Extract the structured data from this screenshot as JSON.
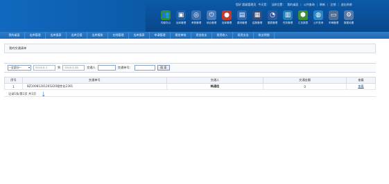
{
  "topbar": [
    "您好 超级管理员",
    "今天是：",
    "当前位置：",
    "我的桌面",
    "公共查询",
    "刷新",
    "注销",
    "退出系统"
  ],
  "modules": [
    {
      "label": "内部办公",
      "icon": "people-icon",
      "color": "#2f8f3a",
      "glyph": "👥"
    },
    {
      "label": "出库管理",
      "icon": "box-out-icon",
      "color": "#1e5fa6",
      "glyph": "▣"
    },
    {
      "label": "考核管理",
      "icon": "target-icon",
      "color": "#3a6fb2",
      "glyph": "◎"
    },
    {
      "label": "综合管理",
      "icon": "power-icon",
      "color": "#4b7cb9",
      "glyph": "⏻"
    },
    {
      "label": "出库管理",
      "icon": "alert-icon",
      "color": "#c33a2f",
      "glyph": "●"
    },
    {
      "label": "费用管理",
      "icon": "document-icon",
      "color": "#2a6bb8",
      "glyph": "▤"
    },
    {
      "label": "结报管理",
      "icon": "report-icon",
      "color": "#37507a",
      "glyph": "▦"
    },
    {
      "label": "图表管理",
      "icon": "dashboard-icon",
      "color": "#2c5aa0",
      "glyph": "◔"
    },
    {
      "label": "任务管理",
      "icon": "chart-icon",
      "color": "#1f7fbf",
      "glyph": "▥"
    },
    {
      "label": "汇总报表",
      "icon": "shop-icon",
      "color": "#3d8d3b",
      "glyph": "⬢"
    },
    {
      "label": "公开查询",
      "icon": "globe-icon",
      "color": "#2b86c6",
      "glyph": "◍"
    },
    {
      "label": "车辆管理",
      "icon": "monitor-icon",
      "color": "#4f6f96",
      "glyph": "▭"
    },
    {
      "label": "数据设置",
      "icon": "settings-icon",
      "color": "#557aa6",
      "glyph": "⚙"
    }
  ],
  "nav": [
    "我的桌面",
    "出库管理",
    "出库报表",
    "出库日报",
    "出库报账",
    "在线管理",
    "出库报表",
    "申请管理",
    "报批审核",
    "资金收支",
    "投资收入",
    "投资支出",
    "收支明细"
  ],
  "breadcrumb": "我的交通清单",
  "filter": {
    "select_value": "--全部分--",
    "date_from": "2019-5-1",
    "to_label": "到",
    "date_to": "2019-5-28",
    "person_label": "交通人",
    "order_label": "交通单号：",
    "search_button": "搜 索"
  },
  "table": {
    "headers": [
      "序号",
      "交通单号",
      "交通人",
      "交通金额",
      "查看"
    ],
    "rows": [
      {
        "index": "1",
        "order_no": "BZ10081201205220理性化2301",
        "person": "韩通信",
        "amount": "0",
        "action": "查看"
      }
    ]
  },
  "footer": {
    "summary": "记录1条/第1页  共1页",
    "page": "1"
  }
}
